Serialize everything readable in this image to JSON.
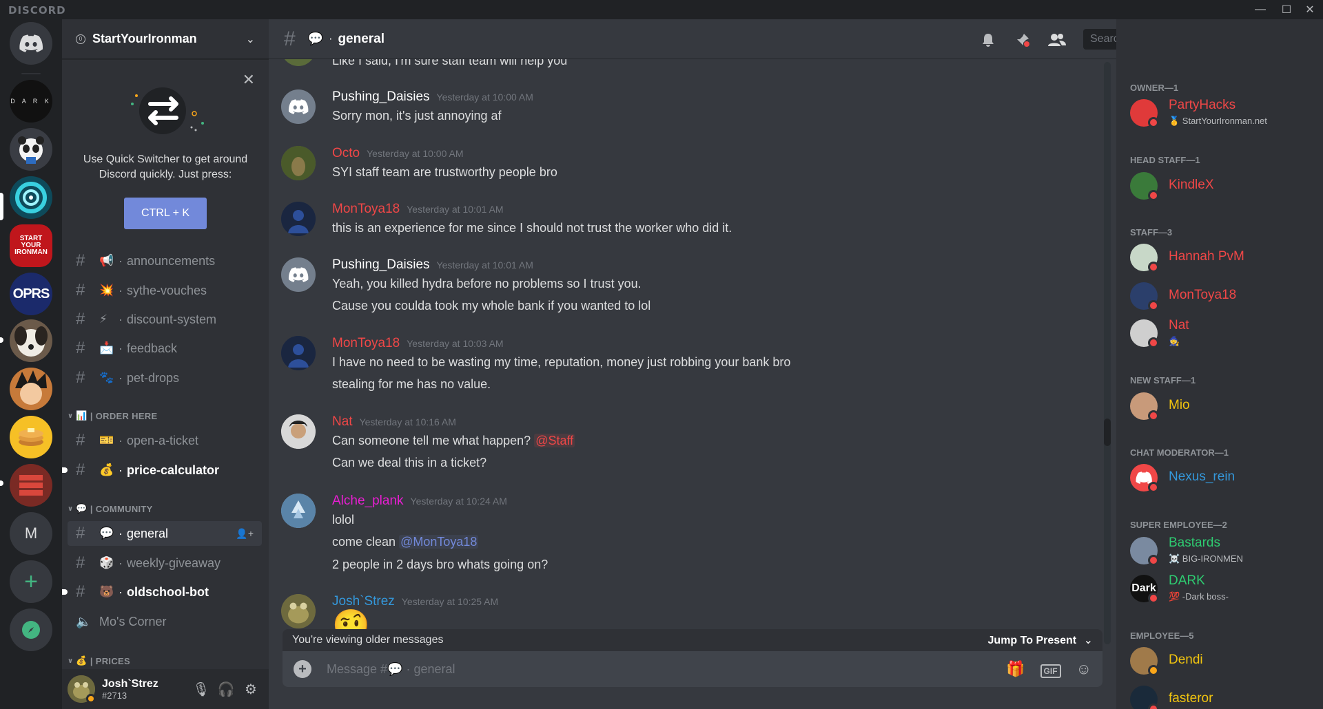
{
  "window": {
    "app_name": "DISCORD",
    "controls": [
      "—",
      "☐",
      "✕"
    ]
  },
  "servers": [
    {
      "name": "Home",
      "label": "",
      "color": "#36393f"
    },
    {
      "name": "DARK",
      "label": "D A R K",
      "color": "#111111"
    },
    {
      "name": "Panda",
      "label": "",
      "color": "#e8e8e8"
    },
    {
      "name": "Portal",
      "label": "",
      "color": "#1aa6b7"
    },
    {
      "name": "StartYourIronman",
      "label": "START YOUR IRONMAN",
      "color": "#c0161c"
    },
    {
      "name": "OPRS",
      "label": "OPRS",
      "color": "#1b2a6b"
    },
    {
      "name": "Dog",
      "label": "",
      "color": "#6b5a4a"
    },
    {
      "name": "Goku",
      "label": "",
      "color": "#c77a3a"
    },
    {
      "name": "Pancakes",
      "label": "",
      "color": "#f6c026"
    },
    {
      "name": "Brick",
      "label": "",
      "color": "#b8342c"
    },
    {
      "name": "M",
      "label": "M",
      "color": "#36393f"
    }
  ],
  "guild": {
    "name": "StartYourIronman",
    "badge": "0"
  },
  "quick_switcher": {
    "text": "Use Quick Switcher to get around Discord quickly. Just press:",
    "button": "CTRL + K"
  },
  "channels_top": [
    {
      "emoji": "📢",
      "name": "announcements",
      "bright": false
    },
    {
      "emoji": "💥",
      "name": "sythe-vouches",
      "bright": false
    },
    {
      "emoji": "⚡",
      "name": "discount-system",
      "bright": false
    },
    {
      "emoji": "📩",
      "name": "feedback",
      "bright": false
    },
    {
      "emoji": "🐾",
      "name": "pet-drops",
      "bright": false
    }
  ],
  "category_order": {
    "emoji": "📊",
    "label": "| ORDER HERE"
  },
  "channels_order": [
    {
      "emoji": "🎫",
      "name": "open-a-ticket",
      "bright": false
    },
    {
      "emoji": "💰",
      "name": "price-calculator",
      "bright": true
    }
  ],
  "category_community": {
    "emoji": "💬",
    "label": "| COMMUNITY"
  },
  "channels_community": [
    {
      "emoji": "💬",
      "name": "general",
      "bright": true
    },
    {
      "emoji": "🎲",
      "name": "weekly-giveaway",
      "bright": false
    },
    {
      "emoji": "🐻",
      "name": "oldschool-bot",
      "bright": true
    }
  ],
  "voice_channel": {
    "name": "Mo's Corner"
  },
  "category_prices": {
    "emoji": "💰",
    "label": "| PRICES"
  },
  "user": {
    "name": "Josh`Strez",
    "tag": "#2713"
  },
  "channel_header": {
    "emoji": "💬",
    "name": "general"
  },
  "search": {
    "placeholder": "Search"
  },
  "cut_line": "Like I said, I'm sure staff team will help you",
  "messages": [
    {
      "author": "Pushing_Daisies",
      "color": "#ffffff",
      "time": "Yesterday at 10:00 AM",
      "avatar": "discord",
      "avcolor": "#747f8d",
      "lines": [
        "Sorry mon, it's just annoying af"
      ]
    },
    {
      "author": "Octo",
      "color": "#f04747",
      "time": "Yesterday at 10:00 AM",
      "avatar": "photo",
      "avcolor": "#5a6b3a",
      "lines": [
        "SYI staff team are trustworthy people bro"
      ]
    },
    {
      "author": "MonToya18",
      "color": "#f04747",
      "time": "Yesterday at 10:01 AM",
      "avatar": "photo",
      "avcolor": "#2b3f6b",
      "lines": [
        "this is an experience for me since I should not trust the worker who did it."
      ]
    },
    {
      "author": "Pushing_Daisies",
      "color": "#ffffff",
      "time": "Yesterday at 10:01 AM",
      "avatar": "discord",
      "avcolor": "#747f8d",
      "lines": [
        "Yeah, you killed hydra before no problems so I trust you.",
        "Cause you coulda took my whole bank if you wanted to lol"
      ]
    },
    {
      "author": "MonToya18",
      "color": "#f04747",
      "time": "Yesterday at 10:03 AM",
      "avatar": "photo",
      "avcolor": "#2b3f6b",
      "lines": [
        "I have no need to be wasting my time, reputation, money just robbing your bank bro",
        "stealing for me has no value."
      ]
    },
    {
      "author": "Nat",
      "color": "#f04747",
      "time": "Yesterday at 10:16 AM",
      "avatar": "photo",
      "avcolor": "#cfcfcf",
      "lines": [
        "Can someone tell me what happen?",
        "Can we deal this in a ticket?"
      ],
      "mention": "@Staff"
    },
    {
      "author": "Alche_plank",
      "color": "#e91ed3",
      "time": "Yesterday at 10:24 AM",
      "avatar": "photo",
      "avcolor": "#7aa4c8",
      "lines": [
        "lolol",
        "come clean",
        "2 people in 2 days bro whats going on?"
      ],
      "mention": "@MonToya18"
    },
    {
      "author": "Josh`Strez",
      "color": "#3498db",
      "time": "Yesterday at 10:25 AM",
      "avatar": "photo",
      "avcolor": "#8a7a4a",
      "lines": [
        "🤨"
      ]
    }
  ],
  "older_bar": {
    "text": "You're viewing older messages",
    "jump": "Jump To Present"
  },
  "composer": {
    "placeholder_prefix": "Message #",
    "emoji": "💬",
    "channel": "general"
  },
  "roles": [
    {
      "title": "OWNER—1"
    },
    {
      "title": "HEAD STAFF—1"
    },
    {
      "title": "STAFF—3"
    },
    {
      "title": "NEW STAFF—1"
    },
    {
      "title": "CHAT MODERATOR—1"
    },
    {
      "title": "SUPER EMPLOYEE—2"
    },
    {
      "title": "EMPLOYEE—5"
    }
  ],
  "members": [
    {
      "name": "PartyHacks",
      "color": "#f04747",
      "activity": "🥇 StartYourIronman.net",
      "avcolor": "#e03a3a",
      "status": "dnd"
    },
    {
      "name": "KindleX",
      "color": "#f04747",
      "activity": "",
      "avcolor": "#3a7a3a",
      "status": "dnd"
    },
    {
      "name": "Hannah PvM",
      "color": "#f04747",
      "activity": "",
      "avcolor": "#c8d8c8",
      "status": "dnd"
    },
    {
      "name": "MonToya18",
      "color": "#f04747",
      "activity": "",
      "avcolor": "#2b3f6b",
      "status": "dnd"
    },
    {
      "name": "Nat",
      "color": "#f04747",
      "activity": "🧙",
      "avcolor": "#cfcfcf",
      "status": "dnd"
    },
    {
      "name": "Mio",
      "color": "#f1c40f",
      "activity": "",
      "avcolor": "#c89a7a",
      "status": "dnd"
    },
    {
      "name": "Nexus_rein",
      "color": "#3498db",
      "activity": "",
      "avcolor": "#f04747",
      "status": "dnd"
    },
    {
      "name": "Bastards",
      "color": "#2ecc71",
      "activity": "☠️ BIG-IRONMEN",
      "avcolor": "#7a8aa0",
      "status": "dnd"
    },
    {
      "name": "DARK",
      "color": "#2ecc71",
      "activity": "💯 -Dark boss-",
      "avcolor": "#111111",
      "status": "dnd",
      "avtext": "Dark"
    },
    {
      "name": "Dendi",
      "color": "#f1c40f",
      "activity": "",
      "avcolor": "#a07a4a",
      "status": "idle"
    },
    {
      "name": "fasteror",
      "color": "#f1c40f",
      "activity": "",
      "avcolor": "#1a2a3a",
      "status": "dnd"
    }
  ]
}
